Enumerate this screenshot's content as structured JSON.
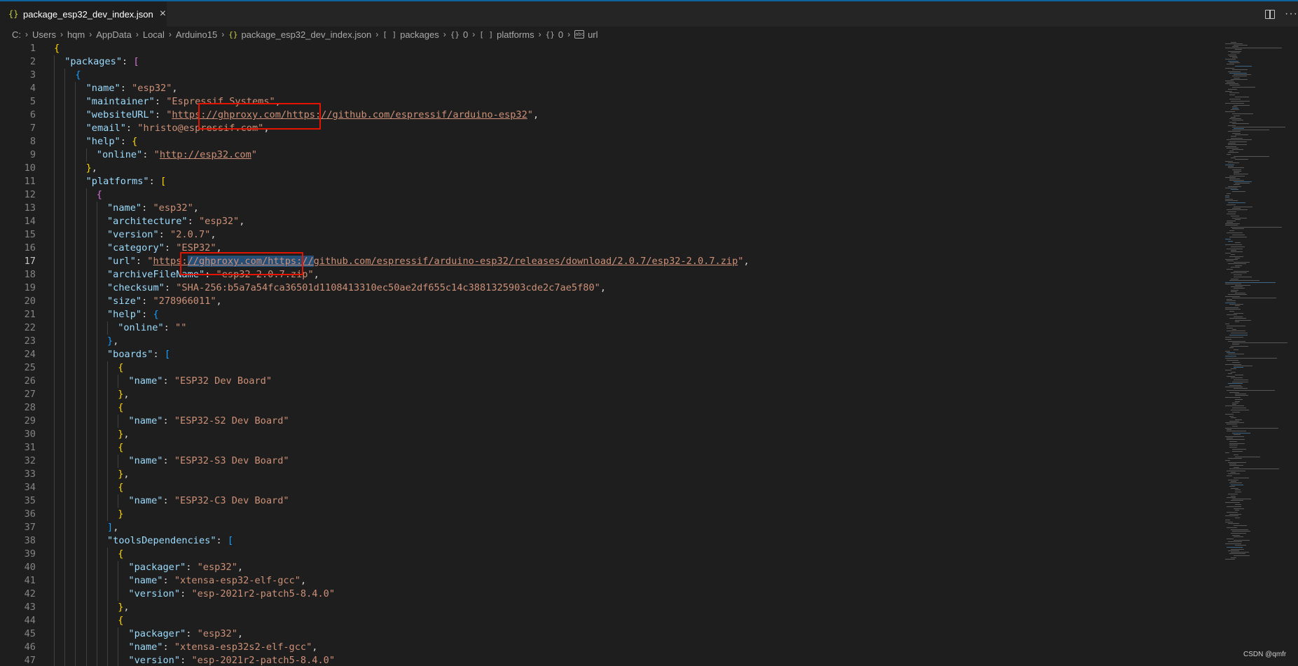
{
  "tab": {
    "icon": "json-braces-icon",
    "title": "package_esp32_dev_index.json",
    "close_icon": "close-icon"
  },
  "toolbar": {
    "split_icon": "split-editor-icon",
    "more_icon": "more-actions-icon"
  },
  "breadcrumb": [
    "C:",
    "Users",
    "hqm",
    "AppData",
    "Local",
    "Arduino15",
    "package_esp32_dev_index.json",
    "packages",
    "0",
    "platforms",
    "0",
    "url"
  ],
  "lines": [
    {
      "n": 1,
      "i": 0,
      "t": [
        [
          "b1",
          "{"
        ]
      ]
    },
    {
      "n": 2,
      "i": 1,
      "t": [
        [
          "k",
          "\"packages\""
        ],
        [
          "p",
          ": "
        ],
        [
          "b2",
          "["
        ]
      ]
    },
    {
      "n": 3,
      "i": 2,
      "t": [
        [
          "b3",
          "{"
        ]
      ]
    },
    {
      "n": 4,
      "i": 3,
      "t": [
        [
          "k",
          "\"name\""
        ],
        [
          "p",
          ": "
        ],
        [
          "s",
          "\"esp32\""
        ],
        [
          "p",
          ","
        ]
      ]
    },
    {
      "n": 5,
      "i": 3,
      "t": [
        [
          "k",
          "\"maintainer\""
        ],
        [
          "p",
          ": "
        ],
        [
          "s",
          "\"Espressif Systems\""
        ],
        [
          "p",
          ","
        ]
      ]
    },
    {
      "n": 6,
      "i": 3,
      "t": [
        [
          "k",
          "\"websiteURL\""
        ],
        [
          "p",
          ": "
        ],
        [
          "s",
          "\""
        ],
        [
          "u",
          "https://ghproxy.com/https://github.com/espressif/arduino-esp32"
        ],
        [
          "s",
          "\""
        ],
        [
          "p",
          ","
        ]
      ]
    },
    {
      "n": 7,
      "i": 3,
      "t": [
        [
          "k",
          "\"email\""
        ],
        [
          "p",
          ": "
        ],
        [
          "s",
          "\"hristo@espressif.com\""
        ],
        [
          "p",
          ","
        ]
      ]
    },
    {
      "n": 8,
      "i": 3,
      "t": [
        [
          "k",
          "\"help\""
        ],
        [
          "p",
          ": "
        ],
        [
          "b1",
          "{"
        ]
      ]
    },
    {
      "n": 9,
      "i": 4,
      "t": [
        [
          "k",
          "\"online\""
        ],
        [
          "p",
          ": "
        ],
        [
          "s",
          "\""
        ],
        [
          "u",
          "http://esp32.com"
        ],
        [
          "s",
          "\""
        ]
      ]
    },
    {
      "n": 10,
      "i": 3,
      "t": [
        [
          "b1",
          "}"
        ],
        [
          "p",
          ","
        ]
      ]
    },
    {
      "n": 11,
      "i": 3,
      "t": [
        [
          "k",
          "\"platforms\""
        ],
        [
          "p",
          ": "
        ],
        [
          "b1",
          "["
        ]
      ]
    },
    {
      "n": 12,
      "i": 4,
      "t": [
        [
          "b2",
          "{"
        ]
      ]
    },
    {
      "n": 13,
      "i": 5,
      "t": [
        [
          "k",
          "\"name\""
        ],
        [
          "p",
          ": "
        ],
        [
          "s",
          "\"esp32\""
        ],
        [
          "p",
          ","
        ]
      ]
    },
    {
      "n": 14,
      "i": 5,
      "t": [
        [
          "k",
          "\"architecture\""
        ],
        [
          "p",
          ": "
        ],
        [
          "s",
          "\"esp32\""
        ],
        [
          "p",
          ","
        ]
      ]
    },
    {
      "n": 15,
      "i": 5,
      "t": [
        [
          "k",
          "\"version\""
        ],
        [
          "p",
          ": "
        ],
        [
          "s",
          "\"2.0.7\""
        ],
        [
          "p",
          ","
        ]
      ]
    },
    {
      "n": 16,
      "i": 5,
      "t": [
        [
          "k",
          "\"category\""
        ],
        [
          "p",
          ": "
        ],
        [
          "s",
          "\"ESP32\""
        ],
        [
          "p",
          ","
        ]
      ]
    },
    {
      "n": 17,
      "i": 5,
      "active": true,
      "t": [
        [
          "k",
          "\"url\""
        ],
        [
          "p",
          ": "
        ],
        [
          "s",
          "\""
        ],
        [
          "u",
          "https:"
        ],
        [
          "uh",
          "//ghproxy.com/https://"
        ],
        [
          "u",
          "github.com/espressif/arduino-esp32/releases/download/2.0.7/esp32-2.0.7.zip"
        ],
        [
          "s",
          "\""
        ],
        [
          "p",
          ","
        ]
      ]
    },
    {
      "n": 18,
      "i": 5,
      "t": [
        [
          "k",
          "\"archiveFileName\""
        ],
        [
          "p",
          ": "
        ],
        [
          "s",
          "\"esp32-2.0.7.zip\""
        ],
        [
          "p",
          ","
        ]
      ]
    },
    {
      "n": 19,
      "i": 5,
      "t": [
        [
          "k",
          "\"checksum\""
        ],
        [
          "p",
          ": "
        ],
        [
          "s",
          "\"SHA-256:b5a7a54fca36501d1108413310ec50ae2df655c14c3881325903cde2c7ae5f80\""
        ],
        [
          "p",
          ","
        ]
      ]
    },
    {
      "n": 20,
      "i": 5,
      "t": [
        [
          "k",
          "\"size\""
        ],
        [
          "p",
          ": "
        ],
        [
          "s",
          "\"278966011\""
        ],
        [
          "p",
          ","
        ]
      ]
    },
    {
      "n": 21,
      "i": 5,
      "t": [
        [
          "k",
          "\"help\""
        ],
        [
          "p",
          ": "
        ],
        [
          "b3",
          "{"
        ]
      ]
    },
    {
      "n": 22,
      "i": 6,
      "t": [
        [
          "k",
          "\"online\""
        ],
        [
          "p",
          ": "
        ],
        [
          "s",
          "\"\""
        ]
      ]
    },
    {
      "n": 23,
      "i": 5,
      "t": [
        [
          "b3",
          "}"
        ],
        [
          "p",
          ","
        ]
      ]
    },
    {
      "n": 24,
      "i": 5,
      "t": [
        [
          "k",
          "\"boards\""
        ],
        [
          "p",
          ": "
        ],
        [
          "b3",
          "["
        ]
      ]
    },
    {
      "n": 25,
      "i": 6,
      "t": [
        [
          "b1",
          "{"
        ]
      ]
    },
    {
      "n": 26,
      "i": 7,
      "t": [
        [
          "k",
          "\"name\""
        ],
        [
          "p",
          ": "
        ],
        [
          "s",
          "\"ESP32 Dev Board\""
        ]
      ]
    },
    {
      "n": 27,
      "i": 6,
      "t": [
        [
          "b1",
          "}"
        ],
        [
          "p",
          ","
        ]
      ]
    },
    {
      "n": 28,
      "i": 6,
      "t": [
        [
          "b1",
          "{"
        ]
      ]
    },
    {
      "n": 29,
      "i": 7,
      "t": [
        [
          "k",
          "\"name\""
        ],
        [
          "p",
          ": "
        ],
        [
          "s",
          "\"ESP32-S2 Dev Board\""
        ]
      ]
    },
    {
      "n": 30,
      "i": 6,
      "t": [
        [
          "b1",
          "}"
        ],
        [
          "p",
          ","
        ]
      ]
    },
    {
      "n": 31,
      "i": 6,
      "t": [
        [
          "b1",
          "{"
        ]
      ]
    },
    {
      "n": 32,
      "i": 7,
      "t": [
        [
          "k",
          "\"name\""
        ],
        [
          "p",
          ": "
        ],
        [
          "s",
          "\"ESP32-S3 Dev Board\""
        ]
      ]
    },
    {
      "n": 33,
      "i": 6,
      "t": [
        [
          "b1",
          "}"
        ],
        [
          "p",
          ","
        ]
      ]
    },
    {
      "n": 34,
      "i": 6,
      "t": [
        [
          "b1",
          "{"
        ]
      ]
    },
    {
      "n": 35,
      "i": 7,
      "t": [
        [
          "k",
          "\"name\""
        ],
        [
          "p",
          ": "
        ],
        [
          "s",
          "\"ESP32-C3 Dev Board\""
        ]
      ]
    },
    {
      "n": 36,
      "i": 6,
      "t": [
        [
          "b1",
          "}"
        ]
      ]
    },
    {
      "n": 37,
      "i": 5,
      "t": [
        [
          "b3",
          "]"
        ],
        [
          "p",
          ","
        ]
      ]
    },
    {
      "n": 38,
      "i": 5,
      "t": [
        [
          "k",
          "\"toolsDependencies\""
        ],
        [
          "p",
          ": "
        ],
        [
          "b3",
          "["
        ]
      ]
    },
    {
      "n": 39,
      "i": 6,
      "t": [
        [
          "b1",
          "{"
        ]
      ]
    },
    {
      "n": 40,
      "i": 7,
      "t": [
        [
          "k",
          "\"packager\""
        ],
        [
          "p",
          ": "
        ],
        [
          "s",
          "\"esp32\""
        ],
        [
          "p",
          ","
        ]
      ]
    },
    {
      "n": 41,
      "i": 7,
      "t": [
        [
          "k",
          "\"name\""
        ],
        [
          "p",
          ": "
        ],
        [
          "s",
          "\"xtensa-esp32-elf-gcc\""
        ],
        [
          "p",
          ","
        ]
      ]
    },
    {
      "n": 42,
      "i": 7,
      "t": [
        [
          "k",
          "\"version\""
        ],
        [
          "p",
          ": "
        ],
        [
          "s",
          "\"esp-2021r2-patch5-8.4.0\""
        ]
      ]
    },
    {
      "n": 43,
      "i": 6,
      "t": [
        [
          "b1",
          "}"
        ],
        [
          "p",
          ","
        ]
      ]
    },
    {
      "n": 44,
      "i": 6,
      "t": [
        [
          "b1",
          "{"
        ]
      ]
    },
    {
      "n": 45,
      "i": 7,
      "t": [
        [
          "k",
          "\"packager\""
        ],
        [
          "p",
          ": "
        ],
        [
          "s",
          "\"esp32\""
        ],
        [
          "p",
          ","
        ]
      ]
    },
    {
      "n": 46,
      "i": 7,
      "t": [
        [
          "k",
          "\"name\""
        ],
        [
          "p",
          ": "
        ],
        [
          "s",
          "\"xtensa-esp32s2-elf-gcc\""
        ],
        [
          "p",
          ","
        ]
      ]
    },
    {
      "n": 47,
      "i": 7,
      "t": [
        [
          "k",
          "\"version\""
        ],
        [
          "p",
          ": "
        ],
        [
          "s",
          "\"esp-2021r2-patch5-8.4.0\""
        ]
      ]
    }
  ],
  "watermark": "CSDN @qmfr"
}
